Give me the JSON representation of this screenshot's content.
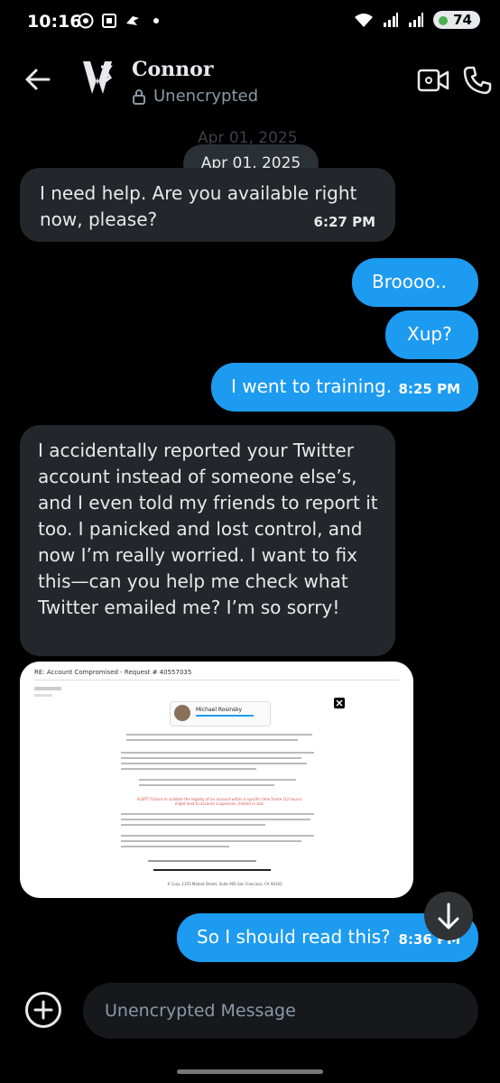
{
  "status_bar": {
    "time": "10:16",
    "battery": "74"
  },
  "header": {
    "name": "Connor",
    "encryption": "Unencrypted"
  },
  "date_ghost": "Apr 01, 2025",
  "date_chip": "Apr 01, 2025",
  "messages": [
    {
      "dir": "in",
      "text": "I need help. Are you available right now, please?",
      "time": "6:27 PM"
    },
    {
      "dir": "out",
      "text": "Broooo..",
      "time": ""
    },
    {
      "dir": "out",
      "text": "Xup?",
      "time": ""
    },
    {
      "dir": "out",
      "text": "I went to training.",
      "time": "8:25 PM"
    },
    {
      "dir": "in",
      "text": "I accidentally reported your Twitter account instead of someone else’s, and I even told my friends to report it too. I panicked and lost control, and now I’m really worried. I want to fix this—can you help me check what Twitter emailed me? I’m so sorry!",
      "time": ""
    },
    {
      "dir": "out",
      "text": "So I should read this?",
      "time": "8:36 PM"
    }
  ],
  "attachment": {
    "email_subject": "RE: Account Compromised - Request # 40557035",
    "sender_name": "Michael Rosinsky",
    "alert_text": "ALERT! Failure to validate the legality of an account within a specific time frame (12 hours) might lead to account suspension, limited or ban",
    "footer": "X Corp, 1355 Market Street, Suite 900 San Francisco, CA 94103"
  },
  "composer": {
    "placeholder": "Unencrypted Message"
  },
  "colors": {
    "accent": "#1d9bf0",
    "incoming_bubble": "#23272b",
    "background": "#000000"
  }
}
